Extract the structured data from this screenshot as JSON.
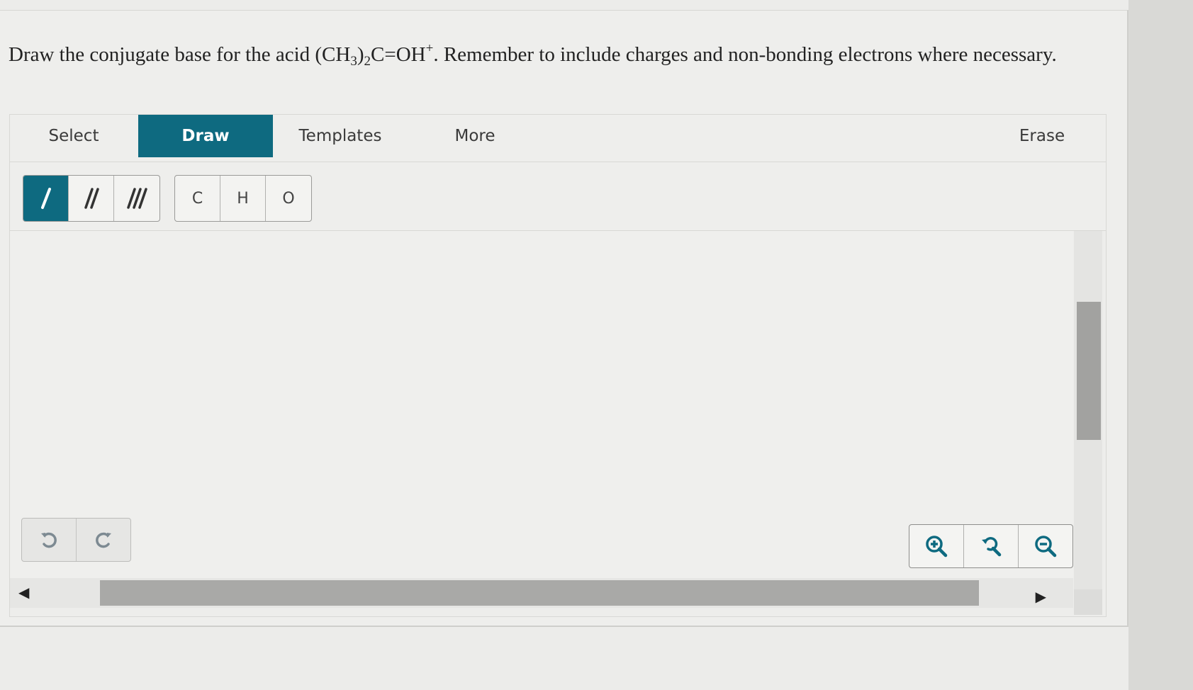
{
  "question": {
    "part1": "Draw the conjugate base for the acid (CH",
    "sub1": "3",
    "part2": ")",
    "sub2": "2",
    "part3": "C=OH",
    "sup1": "+",
    "part4": ". Remember to include charges and non-bonding electrons where necessary."
  },
  "tabs": {
    "select": "Select",
    "draw": "Draw",
    "templates": "Templates",
    "more": "More",
    "erase": "Erase",
    "active": "draw"
  },
  "bond_tools": {
    "single": "single-bond",
    "double": "double-bond",
    "triple": "triple-bond",
    "selected": "single"
  },
  "atoms": [
    "C",
    "H",
    "O"
  ],
  "icons": {
    "undo": "undo-icon",
    "redo": "redo-icon",
    "zoom_in": "zoom-in-icon",
    "zoom_reset": "zoom-reset-icon",
    "zoom_out": "zoom-out-icon"
  },
  "colors": {
    "accent": "#0e6a80",
    "text": "#222222"
  }
}
